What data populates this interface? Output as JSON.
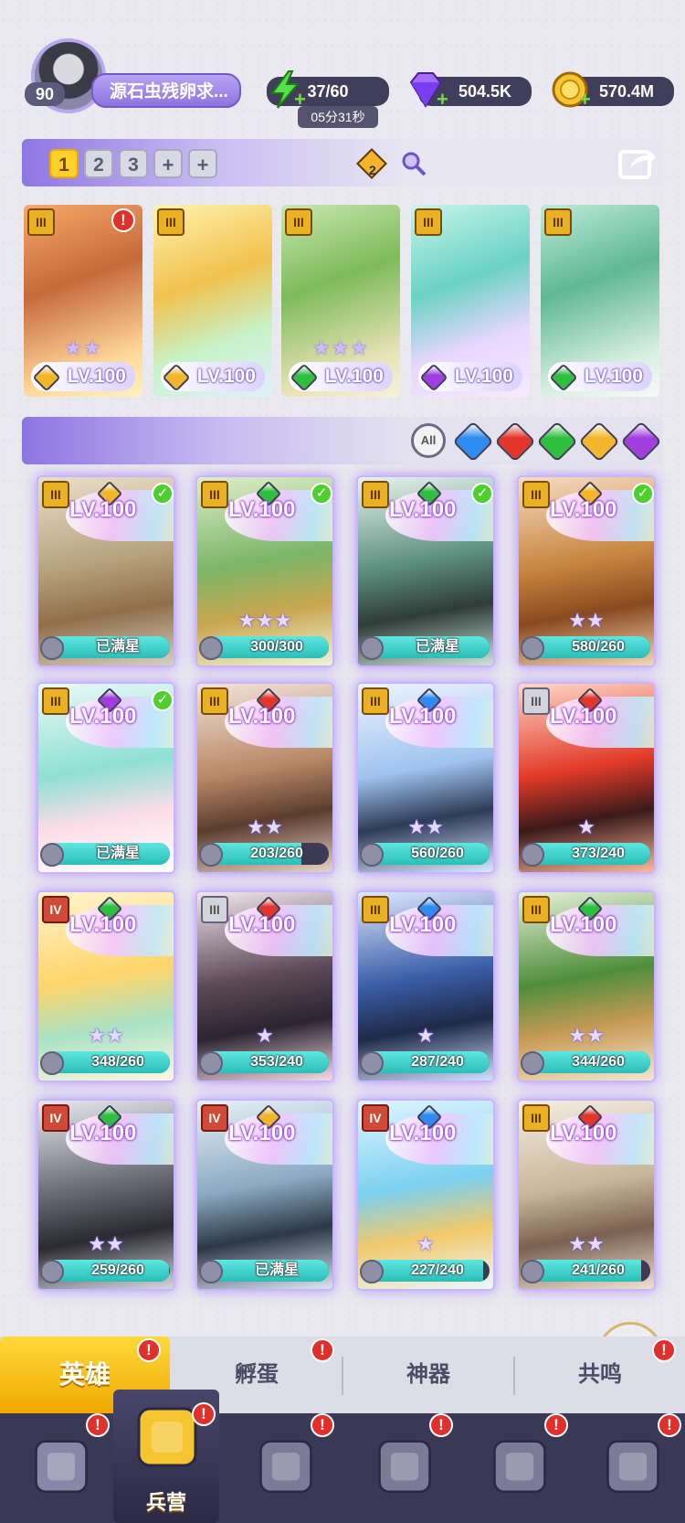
{
  "player": {
    "level": "90",
    "name": "源石虫残卵求..."
  },
  "resources": {
    "energy": {
      "value": "37/60",
      "timer": "05分31秒",
      "icon": "lightning-icon"
    },
    "gems": {
      "value": "504.5K",
      "icon": "purple-gem-icon"
    },
    "gold": {
      "value": "570.4M",
      "icon": "gold-coin-icon"
    }
  },
  "teams": {
    "tabs": [
      "1",
      "2",
      "3",
      "+",
      "+"
    ],
    "active": "1",
    "badge_count": "2"
  },
  "lineup": [
    {
      "level": "LV.100",
      "element": "light",
      "tier": "III",
      "stars": "★★",
      "alert": "!"
    },
    {
      "level": "LV.100",
      "element": "light",
      "tier": "III",
      "stars": "",
      "alert": ""
    },
    {
      "level": "LV.100",
      "element": "wind",
      "tier": "III",
      "stars": "★★★",
      "alert": ""
    },
    {
      "level": "LV.100",
      "element": "dark",
      "tier": "III",
      "stars": "",
      "alert": ""
    },
    {
      "level": "LV.100",
      "element": "wind",
      "tier": "III",
      "stars": "",
      "alert": ""
    }
  ],
  "filters": {
    "all_label": "All",
    "elements": [
      "water",
      "fire",
      "wind",
      "light",
      "dark"
    ]
  },
  "colors": {
    "water": "#2e8bf0",
    "fire": "#e4352a",
    "wind": "#2fbf3f",
    "light": "#f3b62a",
    "dark": "#a03ee0",
    "accent": "#8e72e0"
  },
  "heroes": [
    {
      "level": "LV.100",
      "element": "light",
      "tier": "III",
      "tier_style": "gold",
      "checked": true,
      "stars": "",
      "progress_text": "已满星",
      "progress": 1.0
    },
    {
      "level": "LV.100",
      "element": "wind",
      "tier": "III",
      "tier_style": "gold",
      "checked": true,
      "stars": "★★★",
      "progress_text": "300/300",
      "progress": 1.0
    },
    {
      "level": "LV.100",
      "element": "wind",
      "tier": "III",
      "tier_style": "gold",
      "checked": true,
      "stars": "",
      "progress_text": "已满星",
      "progress": 1.0
    },
    {
      "level": "LV.100",
      "element": "light",
      "tier": "III",
      "tier_style": "gold",
      "checked": true,
      "stars": "★★",
      "progress_text": "580/260",
      "progress": 1.0
    },
    {
      "level": "LV.100",
      "element": "dark",
      "tier": "III",
      "tier_style": "gold",
      "checked": true,
      "stars": "",
      "progress_text": "已满星",
      "progress": 1.0
    },
    {
      "level": "LV.100",
      "element": "fire",
      "tier": "III",
      "tier_style": "gold",
      "checked": false,
      "stars": "★★",
      "progress_text": "203/260",
      "progress": 0.78
    },
    {
      "level": "LV.100",
      "element": "water",
      "tier": "III",
      "tier_style": "gold",
      "checked": false,
      "stars": "★★",
      "progress_text": "560/260",
      "progress": 1.0
    },
    {
      "level": "LV.100",
      "element": "fire",
      "tier": "III",
      "tier_style": "gray",
      "checked": false,
      "stars": "★",
      "progress_text": "373/240",
      "progress": 1.0
    },
    {
      "level": "LV.100",
      "element": "wind",
      "tier": "IV",
      "tier_style": "red",
      "checked": false,
      "stars": "★★",
      "progress_text": "348/260",
      "progress": 1.0
    },
    {
      "level": "LV.100",
      "element": "fire",
      "tier": "III",
      "tier_style": "gray",
      "checked": false,
      "stars": "★",
      "progress_text": "353/240",
      "progress": 1.0
    },
    {
      "level": "LV.100",
      "element": "water",
      "tier": "III",
      "tier_style": "gold",
      "checked": false,
      "stars": "★",
      "progress_text": "287/240",
      "progress": 1.0
    },
    {
      "level": "LV.100",
      "element": "wind",
      "tier": "III",
      "tier_style": "gold",
      "checked": false,
      "stars": "★★",
      "progress_text": "344/260",
      "progress": 1.0
    },
    {
      "level": "LV.100",
      "element": "wind",
      "tier": "IV",
      "tier_style": "red",
      "checked": false,
      "stars": "★★",
      "progress_text": "259/260",
      "progress": 0.99
    },
    {
      "level": "LV.100",
      "element": "light",
      "tier": "IV",
      "tier_style": "red",
      "checked": false,
      "stars": "",
      "progress_text": "已满星",
      "progress": 1.0
    },
    {
      "level": "LV.100",
      "element": "water",
      "tier": "IV",
      "tier_style": "red",
      "checked": false,
      "stars": "★",
      "progress_text": "227/240",
      "progress": 0.95
    },
    {
      "level": "LV.100",
      "element": "fire",
      "tier": "III",
      "tier_style": "gold",
      "checked": false,
      "stars": "★★",
      "progress_text": "241/260",
      "progress": 0.93
    }
  ],
  "tabs": [
    {
      "label": "英雄",
      "active": true,
      "alert": "!"
    },
    {
      "label": "孵蛋",
      "active": false,
      "alert": "!"
    },
    {
      "label": "神器",
      "active": false,
      "alert": ""
    },
    {
      "label": "共鸣",
      "active": false,
      "alert": "!"
    }
  ],
  "nav": [
    {
      "name": "cards-icon",
      "alert": "!",
      "label": ""
    },
    {
      "name": "barracks-icon",
      "alert": "!",
      "label": "兵营"
    },
    {
      "name": "map-icon",
      "alert": "!",
      "label": ""
    },
    {
      "name": "castle-icon",
      "alert": "!",
      "label": ""
    },
    {
      "name": "mushroom-house-icon",
      "alert": "!",
      "label": ""
    },
    {
      "name": "banner-icon",
      "alert": "!",
      "label": ""
    }
  ]
}
